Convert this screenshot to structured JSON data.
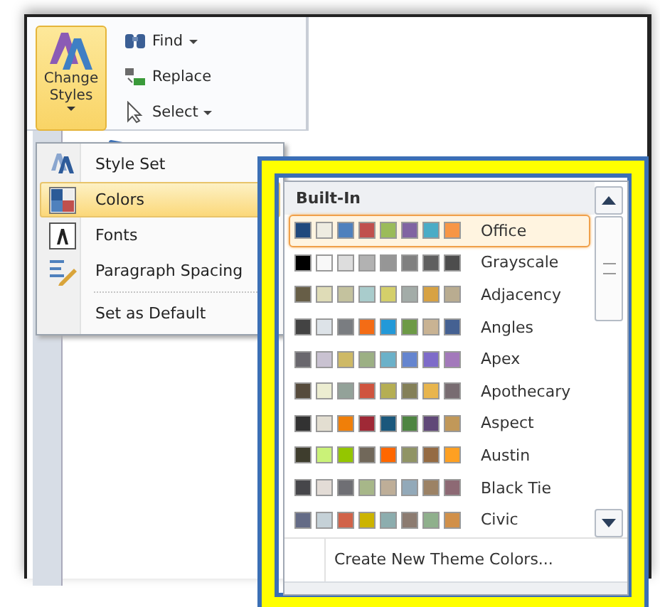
{
  "ribbon": {
    "change_styles": {
      "label": "Change Styles",
      "selected": true
    },
    "editing": [
      {
        "kind": "find",
        "label": "Find",
        "dropdown": true
      },
      {
        "kind": "replace",
        "label": "Replace",
        "dropdown": false
      },
      {
        "kind": "select",
        "label": "Select",
        "dropdown": true
      }
    ]
  },
  "menu": {
    "items": [
      {
        "kind": "styleset",
        "label": "Style Set",
        "selected": false
      },
      {
        "kind": "colors",
        "label": "Colors",
        "selected": true
      },
      {
        "kind": "fonts",
        "label": "Fonts",
        "selected": false
      },
      {
        "kind": "spacing",
        "label": "Paragraph Spacing",
        "selected": false
      },
      {
        "kind": "none",
        "label": "Set as Default",
        "selected": false
      }
    ]
  },
  "gallery": {
    "header": "Built-In",
    "themes": [
      {
        "name": "Office",
        "selected": true,
        "swatches": [
          {
            "color": "#1f497d"
          },
          {
            "color": "#eeece1"
          },
          {
            "color": "#4f81bd"
          },
          {
            "color": "#c0504d"
          },
          {
            "color": "#9bbb59"
          },
          {
            "color": "#8064a2"
          },
          {
            "color": "#4bacc6"
          },
          {
            "color": "#f79646"
          }
        ]
      },
      {
        "name": "Grayscale",
        "selected": false,
        "swatches": [
          {
            "color": "#000000"
          },
          {
            "color": "#f8f8f8"
          },
          {
            "color": "#dddddd"
          },
          {
            "color": "#b2b2b2"
          },
          {
            "color": "#969696"
          },
          {
            "color": "#808080"
          },
          {
            "color": "#5f5f5f"
          },
          {
            "color": "#4d4d4d"
          }
        ]
      },
      {
        "name": "Adjacency",
        "selected": false,
        "swatches": [
          {
            "color": "#675e47"
          },
          {
            "color": "#dfdcb7"
          },
          {
            "color": "#c4c29e"
          },
          {
            "color": "#a9cccc"
          },
          {
            "color": "#d4cf6a"
          },
          {
            "color": "#a3aca8"
          },
          {
            "color": "#d7a243"
          },
          {
            "color": "#b9ac90"
          }
        ]
      },
      {
        "name": "Angles",
        "selected": false,
        "swatches": [
          {
            "color": "#434343"
          },
          {
            "color": "#dde3e8"
          },
          {
            "color": "#7a7d81"
          },
          {
            "color": "#f46c15"
          },
          {
            "color": "#2399d8"
          },
          {
            "color": "#6d9a46"
          },
          {
            "color": "#c9b393"
          },
          {
            "color": "#456192"
          }
        ]
      },
      {
        "name": "Apex",
        "selected": false,
        "swatches": [
          {
            "color": "#69676d"
          },
          {
            "color": "#c9c2d1"
          },
          {
            "color": "#ceb966"
          },
          {
            "color": "#9cb084"
          },
          {
            "color": "#6bb1c9"
          },
          {
            "color": "#6585cf"
          },
          {
            "color": "#7e6bc9"
          },
          {
            "color": "#a379bb"
          }
        ]
      },
      {
        "name": "Apothecary",
        "selected": false,
        "swatches": [
          {
            "color": "#564b3c"
          },
          {
            "color": "#ecedd1"
          },
          {
            "color": "#93a299"
          },
          {
            "color": "#cf543f"
          },
          {
            "color": "#b5ae53"
          },
          {
            "color": "#848058"
          },
          {
            "color": "#e8b54d"
          },
          {
            "color": "#786c71"
          }
        ]
      },
      {
        "name": "Aspect",
        "selected": false,
        "swatches": [
          {
            "color": "#323232"
          },
          {
            "color": "#e3ded1"
          },
          {
            "color": "#f07f09"
          },
          {
            "color": "#9f2936"
          },
          {
            "color": "#1b587c"
          },
          {
            "color": "#4e8542"
          },
          {
            "color": "#604878"
          },
          {
            "color": "#c19859"
          }
        ]
      },
      {
        "name": "Austin",
        "selected": false,
        "swatches": [
          {
            "color": "#3e3d2d"
          },
          {
            "color": "#caf278"
          },
          {
            "color": "#94c600"
          },
          {
            "color": "#71685a"
          },
          {
            "color": "#ff6700"
          },
          {
            "color": "#909465"
          },
          {
            "color": "#956b43"
          },
          {
            "color": "#fea022"
          }
        ]
      },
      {
        "name": "Black Tie",
        "selected": false,
        "swatches": [
          {
            "color": "#46464a"
          },
          {
            "color": "#e3dcd6"
          },
          {
            "color": "#6f6f74"
          },
          {
            "color": "#a7b789"
          },
          {
            "color": "#beae98"
          },
          {
            "color": "#92a9b9"
          },
          {
            "color": "#9c8265"
          },
          {
            "color": "#8d6974"
          }
        ]
      },
      {
        "name": "Civic",
        "selected": false,
        "swatches": [
          {
            "color": "#646b86"
          },
          {
            "color": "#c5d1d7"
          },
          {
            "color": "#d16349"
          },
          {
            "color": "#ccb400"
          },
          {
            "color": "#8cadae"
          },
          {
            "color": "#8c7b70"
          },
          {
            "color": "#8fb08c"
          },
          {
            "color": "#d19049"
          }
        ]
      }
    ],
    "footer": "Create New Theme Colors..."
  }
}
